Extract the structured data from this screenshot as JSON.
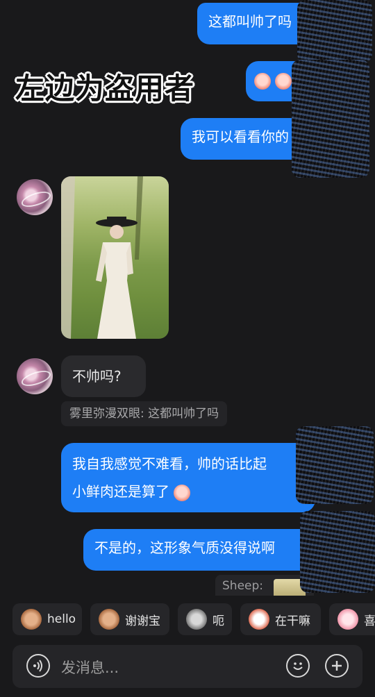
{
  "overlay": {
    "title": "左边为盗用者"
  },
  "messages": {
    "out1": "这都叫帅了吗",
    "out3": "我可以看看你的",
    "in_text": "不帅吗?",
    "quote": "雾里弥漫双眼: 这都叫帅了吗",
    "out4_line1": "我自我感觉不难看，帅的话比起",
    "out4_line2": "小鲜肉还是算了",
    "out5": "不是的，这形象气质没得说啊",
    "sheep_label": "Sheep:"
  },
  "quick_replies": [
    {
      "label": "hello",
      "icon": "monkey-sticker-icon"
    },
    {
      "label": "谢谢宝",
      "icon": "monkey-flower-sticker-icon"
    },
    {
      "label": "呃",
      "icon": "cat-sticker-icon"
    },
    {
      "label": "在干嘛",
      "icon": "face-sticker-icon"
    },
    {
      "label": "喜",
      "icon": "pink-face-sticker-icon"
    }
  ],
  "composer": {
    "placeholder": "发消息..."
  },
  "colors": {
    "background": "#19191b",
    "bubble_out": "#1e7ef5",
    "bubble_in": "#2a2a2d"
  }
}
